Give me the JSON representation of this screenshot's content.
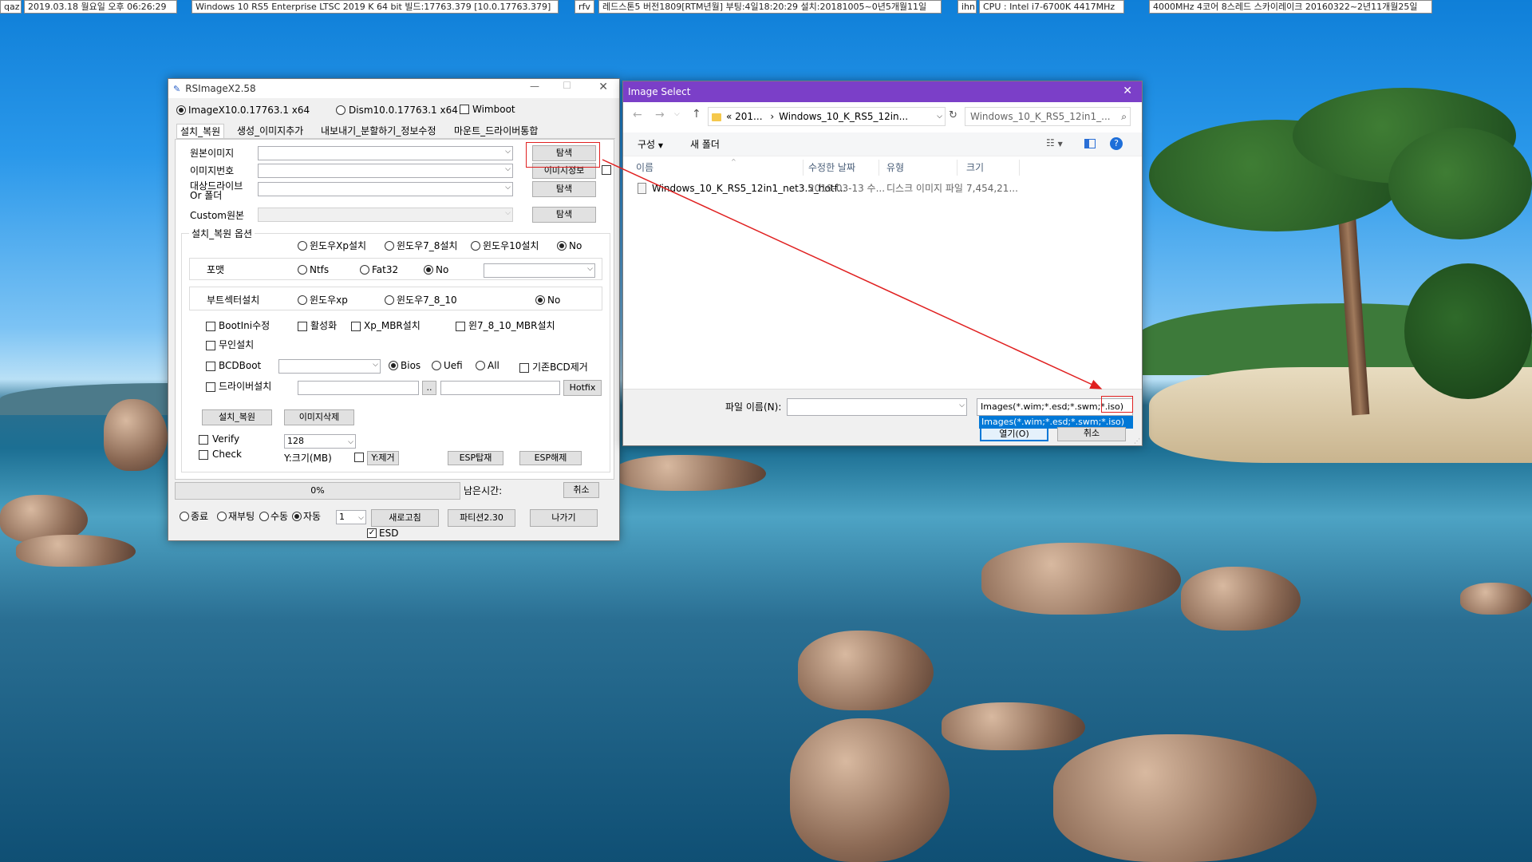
{
  "topbar": {
    "items": [
      "qaz",
      "2019.03.18 월요일 오후 06:26:29",
      "Windows 10 RS5 Enterprise LTSC 2019 K 64 bit 빌드:17763.379 [10.0.17763.379]",
      "rfv",
      "레드스톤5 버전1809[RTM년월] 부팅:4일18:20:29 설치:20181005~0년5개월11일",
      "ihn",
      "CPU : Intel i7-6700K 4417MHz",
      "4000MHz 4코어 8스레드 스카이레이크 20160322~2년11개월25일"
    ]
  },
  "rs": {
    "title": "RSImageX2.58",
    "radio_imagex": "ImageX10.0.17763.1 x64",
    "radio_dism": "Dism10.0.17763.1 x64",
    "wimboot": "Wimboot",
    "tabs": [
      "설치_복원",
      "생성_이미지추가",
      "내보내기_분할하기_정보수정",
      "마운트_드라이버통합"
    ],
    "source_image": "원본이미지",
    "image_number": "이미지번호",
    "target_drive": "대상드라이브",
    "or_folder": "Or 폴더",
    "custom_source": "Custom원본",
    "browse": "탐색",
    "image_info": "이미지정보",
    "install_options": "설치_복원 옵션",
    "opt_xp": "윈도우Xp설치",
    "opt_78": "윈도우7_8설치",
    "opt_10": "윈도우10설치",
    "no": "No",
    "format": "포맷",
    "ntfs": "Ntfs",
    "fat32": "Fat32",
    "boot_sector": "부트섹터설치",
    "bs_xp": "윈도우xp",
    "bs_78_10": "윈도우7_8_10",
    "bootini": "BootIni수정",
    "activate": "활성화",
    "xp_mbr": "Xp_MBR설치",
    "w7_mbr": "윈7_8_10_MBR설치",
    "unattended": "무인설치",
    "bcdboot": "BCDBoot",
    "bios": "Bios",
    "uefi": "Uefi",
    "all": "All",
    "remove_bcd": "기존BCD제거",
    "driver_install": "드라이버설치",
    "dotdot": "..",
    "hotfix": "Hotfix",
    "install_restore": "설치_복원",
    "delete_image": "이미지삭제",
    "verify": "Verify",
    "check": "Check",
    "size_value": "128",
    "y_size": "Y:크기(MB)",
    "y_remove": "Y:제거",
    "esp_mount": "ESP탑재",
    "esp_unmount": "ESP해제",
    "progress": "0%",
    "progress_value": 0,
    "remaining": "남은시간:",
    "cancel": "취소",
    "shutdown": "종료",
    "reboot": "재부팅",
    "manual": "수동",
    "auto": "자동",
    "count_value": "1",
    "refresh": "새로고침",
    "partition": "파티션2.30",
    "exit": "나가기",
    "esd": "ESD"
  },
  "dlg": {
    "title": "Image Select",
    "path_prefix": "201...",
    "path_sep": "›",
    "path_current": "Windows_10_K_RS5_12in...",
    "search_placeholder": "Windows_10_K_RS5_12in1_...",
    "organize": "구성",
    "new_folder": "새 폴더",
    "col_name": "이름",
    "col_date": "수정한 날짜",
    "col_type": "유형",
    "col_size": "크기",
    "file": {
      "name": "Windows_10_K_RS5_12in1_net3.5_hotf...",
      "date": "2019-03-13 수...",
      "type": "디스크 이미지 파일",
      "size": "7,454,21..."
    },
    "filename_label": "파일 이름(N):",
    "filter": "Images(*.wim;*.esd;*.swm;*.iso)",
    "filter_option": "Images(*.wim;*.esd;*.swm;*.iso)",
    "open": "열기(O)",
    "cancel": "취소"
  },
  "colors": {
    "dialog_title": "#7b3fc8",
    "highlight": "#0078d7",
    "annotation": "#e02020"
  }
}
